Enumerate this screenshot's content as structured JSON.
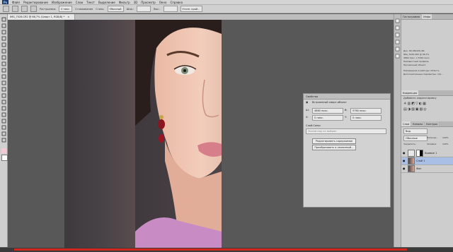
{
  "menubar": {
    "logo": "Ps",
    "items": [
      "Файл",
      "Редактирование",
      "Изображение",
      "Слои",
      "Текст",
      "Выделение",
      "Фильтр",
      "3D",
      "Просмотр",
      "Окно",
      "Справка"
    ]
  },
  "options": {
    "mode_label": "Растушевка:",
    "mode_value": "0 пикс.",
    "smooth_label": "Сглаживание",
    "style_label": "Стиль:",
    "style_value": "Обычный",
    "width_label": "Шир.:",
    "height_label": "Выс.:",
    "refine_label": "Уточн. край..."
  },
  "document_tab": {
    "title": "IMG_7026.CR2 @ 66,7% (Смарт 1, RGB/8) *",
    "close": "×"
  },
  "properties": {
    "tab_label": "Свойства",
    "object_type": "Встроенный смарт-объект",
    "width": "4860 пикс.",
    "height": "5760 пикс.",
    "x": "0 пикс.",
    "y": "0 пикс.",
    "comp_label": "Слой-Comp",
    "comp_placeholder": "Экземпляр не выбран",
    "btn_edit": "Редактировать содержимое",
    "btn_convert": "Преобразовать в связанный..."
  },
  "right_dock": {
    "tabs_top": [
      "Гистограмма",
      "Инфо"
    ],
    "info_lines": [
      "Док: 80,3М/239,4М",
      "IMG_7026.CR2 @ 66,7%",
      "4860 пикс. x 5760 пикс.",
      "Неизвестный профиль",
      "Прозрачный объект"
    ],
    "hint_lines": [
      "Размещение в рабочую область",
      "Дополнительные параметры: отр..."
    ],
    "adjust_tabs": [
      "Коррекция"
    ],
    "adjust_title": "Добавить корректировку",
    "layer_tabs": [
      "Слои",
      "Каналы",
      "Контуры"
    ],
    "kind_label": "Вид",
    "blend_mode": "Обычные",
    "opacity_label": "Непрозр.:",
    "opacity_value": "100%",
    "fill_label": "Заливка:",
    "fill_value": "100%",
    "lock_label": "Закрепить:",
    "layers": [
      {
        "name": "Кривые 1",
        "visible": "●"
      },
      {
        "name": "Слой 1",
        "visible": "●"
      },
      {
        "name": "Фон",
        "visible": "●"
      }
    ]
  },
  "colors": {
    "accent_red": "#d0281e",
    "selected_layer": "#a9bfe6"
  }
}
